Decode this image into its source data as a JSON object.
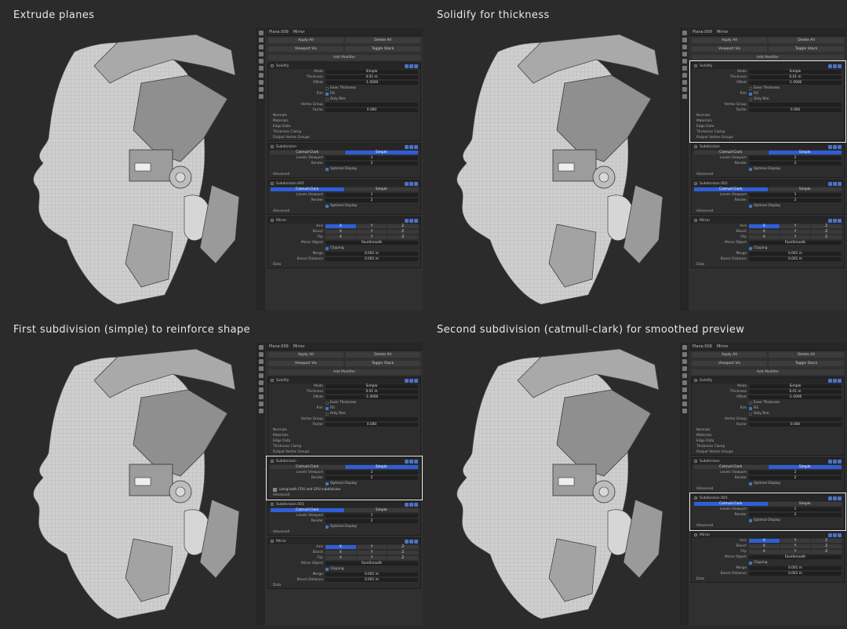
{
  "quads": [
    {
      "title": "Extrude planes",
      "highlight": "none"
    },
    {
      "title": "Solidify for thickness",
      "highlight": "solidify"
    },
    {
      "title": "First subdivision (simple) to reinforce shape",
      "highlight": "subdivision"
    },
    {
      "title": "Second subdivision (catmull-clark) for smoothed preview",
      "highlight": "subdivision001"
    }
  ],
  "panel": {
    "object_name": "Plane.009",
    "modifier_crumb": "Mirror",
    "apply_all": "Apply All",
    "delete_all": "Delete All",
    "viewport_vis": "Viewport Vis",
    "toggle_stack": "Toggle Stack",
    "add_modifier": "Add Modifier",
    "solidify": {
      "name": "Solidify",
      "mode_label": "Mode",
      "mode": "Simple",
      "thickness_label": "Thickness",
      "thickness": "0.01 m",
      "offset_label": "Offset",
      "offset": "-1.0000",
      "even_thickness": "Even Thickness",
      "rim_label": "Rim",
      "fill": "Fill",
      "only_rim": "Only Rim",
      "vgroup_label": "Vertex Group",
      "factor_label": "Factor",
      "factor": "0.000",
      "sections": [
        "Normals",
        "Materials",
        "Edge Data",
        "Thickness Clamp",
        "Output Vertex Groups"
      ]
    },
    "subdivision": {
      "name": "Subdivision",
      "catmull": "Catmull-Clark",
      "simple": "Simple",
      "levels_label": "Levels Viewport",
      "levels": "2",
      "render_label": "Render",
      "render": "2",
      "optimal": "Optimal Display",
      "advanced": "Advanced",
      "gpu_warning": "using both CPU and GPU subdivision"
    },
    "subdivision001": {
      "name": "Subdivision.001",
      "levels": "1",
      "render": "2"
    },
    "mirror": {
      "name": "Mirror",
      "axis_label": "Axis",
      "bisect_label": "Bisect",
      "flip_label": "Flip",
      "x": "X",
      "y": "Y",
      "z": "Z",
      "mirror_object_label": "Mirror Object",
      "mirror_object": "FaceSmooth",
      "clipping": "Clipping",
      "merge_label": "Merge",
      "merge": "0.001 m",
      "bisect_distance_label": "Bisect Distance",
      "bisect_distance": "0.001 m",
      "data": "Data"
    }
  }
}
